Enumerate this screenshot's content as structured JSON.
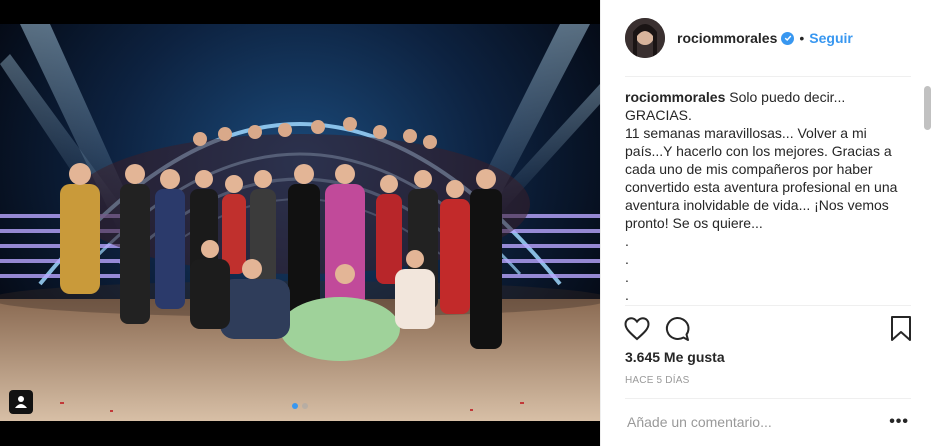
{
  "post": {
    "username": "rociommorales",
    "verified": true,
    "separator": "•",
    "follow_label": "Seguir",
    "caption_username": "rociommorales",
    "caption_text": " Solo puedo decir...\nGRACIAS.\n11 semanas maravillosas... Volver a mi país...Y hacerlo con los mejores. Gracias a cada uno de mis compañeros por haber convertido esta aventura profesional en una aventura inolvidable de vida... ¡Nos vemos pronto! Se os quiere...\n.\n.\n.\n.",
    "likes": "3.645 Me gusta",
    "time": "HACE 5 DÍAS",
    "comment_placeholder": "Añade un comentario...",
    "more_label": "•••"
  },
  "carousel": {
    "slides": 2,
    "active": 1
  },
  "icons": {
    "like": "heart-icon",
    "comment": "comment-bubble-icon",
    "save": "bookmark-icon",
    "user_tag": "user-tag-icon",
    "verified": "verified-badge-icon"
  },
  "colors": {
    "link": "#3897f0",
    "text": "#262626",
    "muted": "#999999",
    "background": "#ffffff"
  }
}
